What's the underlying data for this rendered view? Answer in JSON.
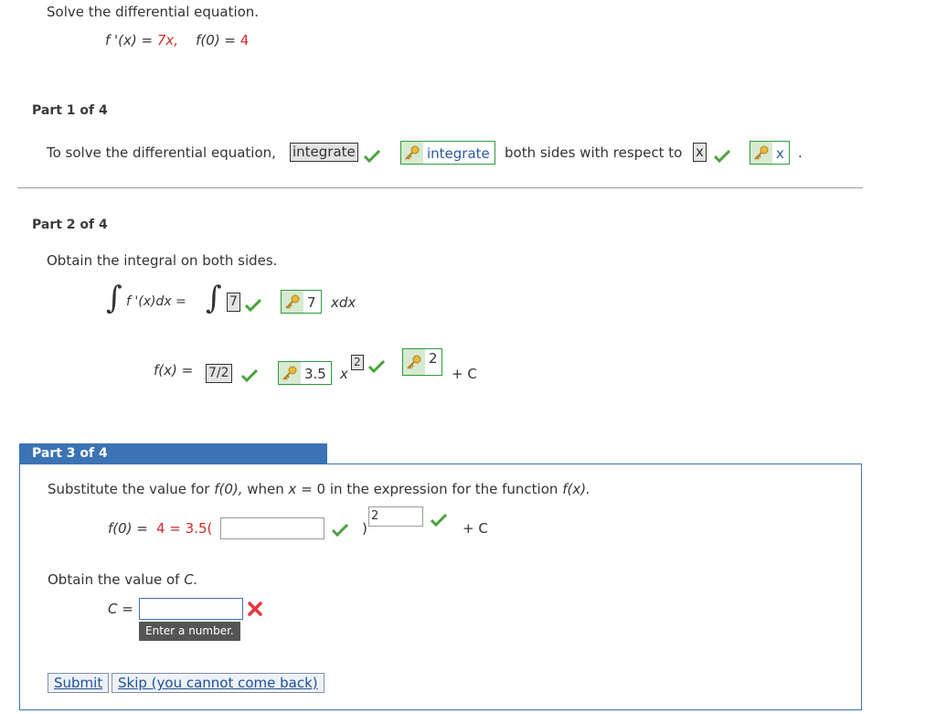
{
  "problem": {
    "instruction": "Solve the differential equation.",
    "eq_lhs": "f '(x) = ",
    "eq_rhs": "7x,",
    "eq_cond_lhs": "f(0) = ",
    "eq_cond_rhs": "4"
  },
  "part1": {
    "label": "Part 1 of 4",
    "text_before": "To solve the differential equation,",
    "answer1": "integrate",
    "key1": "integrate",
    "text_mid": "both sides with respect to",
    "answer2": "x",
    "key2": "x",
    "text_end": "."
  },
  "part2": {
    "label": "Part 2 of 4",
    "instruction": "Obtain the integral on both sides.",
    "integrand_lhs": "f '(x)dx  =",
    "answer_coef": "7",
    "key_coef": "7",
    "integrand_rhs": "xdx",
    "fx_label": "f(x)  =",
    "answer_frac": "7/2",
    "key_frac": "3.5",
    "x_var": "x",
    "answer_exp": "2",
    "key_exp": "2",
    "plus_c": "+ C"
  },
  "part3": {
    "label": "Part 3 of 4",
    "instruction_a": "Substitute the value for ",
    "instruction_f0": "f(0),",
    "instruction_b": " when ",
    "instruction_x": "x",
    "instruction_c": " = 0 in the expression for the function ",
    "instruction_fx": "f(x).",
    "sub_lhs": "f(0) = ",
    "sub_red": "4 = 3.5(",
    "input_value": "",
    "close_paren": ")",
    "exp_value": "2",
    "plus_c": "+ C",
    "obtain_c": "Obtain the value of ",
    "obtain_c_var": "C.",
    "c_label": "C =",
    "c_value": "",
    "tooltip": "Enter a number.",
    "submit_label": "Submit",
    "skip_label": "Skip (you cannot come back)"
  },
  "colors": {
    "accent": "#3b73b4",
    "check": "#4aa33d",
    "error": "#e8343a",
    "red_text": "#d42a2a"
  }
}
